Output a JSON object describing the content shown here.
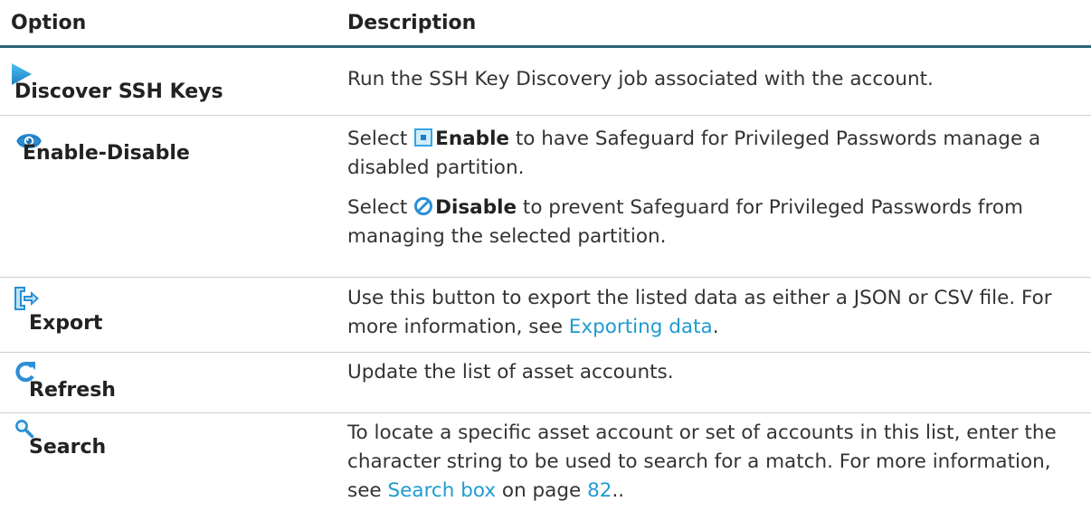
{
  "header": {
    "option": "Option",
    "description": "Description"
  },
  "rows": {
    "discover": {
      "icon": "play-triangle-icon",
      "label": "Discover SSH Keys",
      "description": "Run the SSH Key Discovery job associated with the account."
    },
    "enable_disable": {
      "icon": "eye-icon",
      "label": "Enable-Disable",
      "enable_pre": "Select",
      "enable_icon": "checkbox-square-icon",
      "enable_bold": "Enable",
      "enable_post": "to have Safeguard for Privileged Passwords manage a disabled partition.",
      "disable_pre": "Select",
      "disable_icon": "prohibited-circle-icon",
      "disable_bold": "Disable",
      "disable_post": "to prevent Safeguard for Privileged Passwords from managing the selected partition."
    },
    "export": {
      "icon": "export-arrow-icon",
      "label": "Export",
      "description_pre": "Use this button to export the listed data as either a JSON or CSV file. For more information, see",
      "link": "Exporting data",
      "description_post": "."
    },
    "refresh": {
      "icon": "refresh-icon",
      "label": "Refresh",
      "description": "Update the list of asset accounts."
    },
    "search": {
      "icon": "magnifier-icon",
      "label": "Search",
      "description_pre": "To locate a specific asset account or set of accounts in this list, enter the character string to be used to search for a match. For more information, see",
      "link": "Search box",
      "mid": "on page",
      "page_link": "82",
      "description_post": ".."
    }
  },
  "colors": {
    "accent": "#1f9bd1",
    "header_rule": "#2a6478",
    "text": "#333333"
  }
}
